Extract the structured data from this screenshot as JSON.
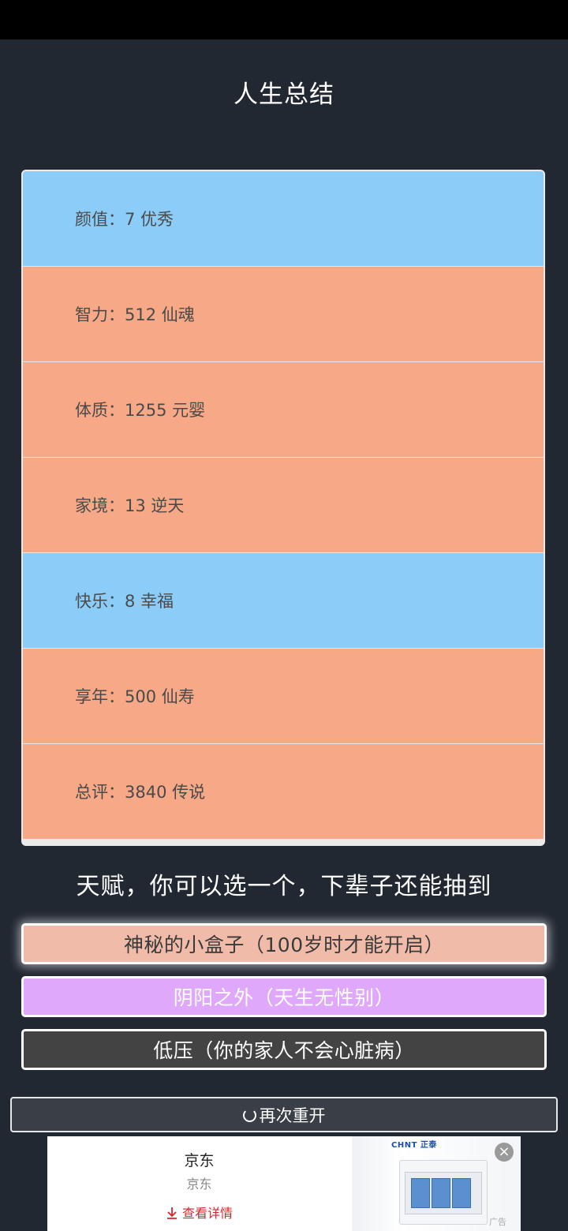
{
  "page": {
    "title": "人生总结"
  },
  "summary": {
    "rows": [
      {
        "label": "颜值：7 优秀",
        "color": "#8bcdf8"
      },
      {
        "label": "智力：512 仙魂",
        "color": "#f6a887"
      },
      {
        "label": "体质：1255 元婴",
        "color": "#f6a887"
      },
      {
        "label": "家境：13 逆天",
        "color": "#f6a887"
      },
      {
        "label": "快乐：8 幸福",
        "color": "#8bcdf8"
      },
      {
        "label": "享年：500 仙寿",
        "color": "#f6a887"
      },
      {
        "label": "总评：3840 传说",
        "color": "#f6a887"
      }
    ]
  },
  "talents": {
    "heading": "天赋，你可以选一个，下辈子还能抽到",
    "options": [
      {
        "label": "神秘的小盒子（100岁时才能开启）",
        "color": "#f0bca9"
      },
      {
        "label": "阴阳之外（天生无性别）",
        "color": "#dfa8fb"
      },
      {
        "label": "低压（你的家人不会心脏病）",
        "color": "#434343"
      }
    ]
  },
  "restart": {
    "label": "再次重开",
    "icon": "refresh-icon"
  },
  "ad": {
    "title": "京东",
    "subtitle": "京东",
    "cta_icon": "download-arrow-icon",
    "cta": "查看详情",
    "brand": "CHNT 正泰",
    "label": "广告",
    "close_icon": "close-icon"
  }
}
